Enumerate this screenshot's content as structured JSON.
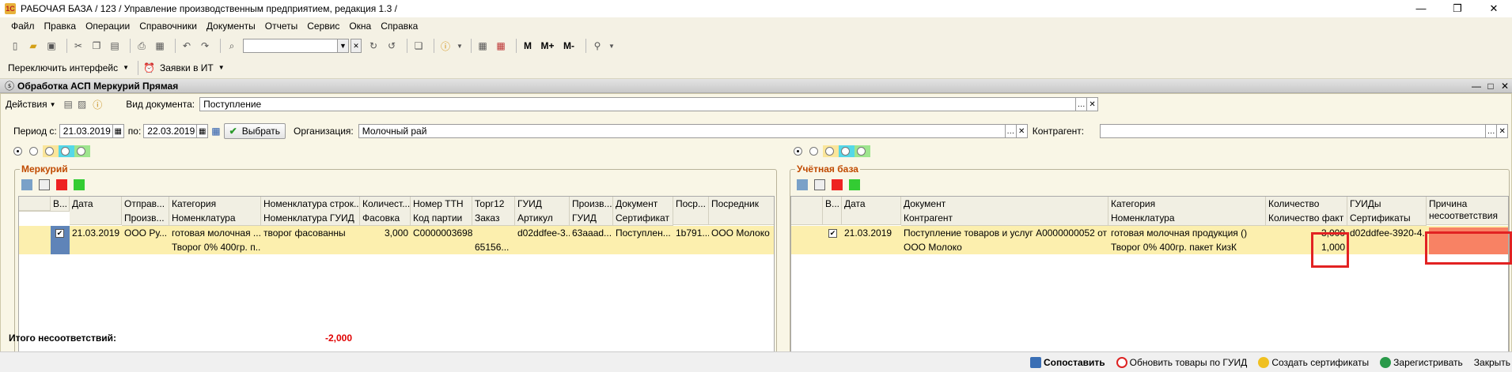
{
  "window": {
    "title": "РАБОЧАЯ БАЗА / 123 /  Управление производственным предприятием, редакция 1.3 /"
  },
  "menu": [
    "Файл",
    "Правка",
    "Операции",
    "Справочники",
    "Документы",
    "Отчеты",
    "Сервис",
    "Окна",
    "Справка"
  ],
  "toolbar2": {
    "switch_interface": "Переключить интерфейс",
    "tickets": "Заявки в ИТ"
  },
  "toolbar1": {
    "m": "M",
    "mplus": "M+",
    "mminus": "M-"
  },
  "form": {
    "title": "Обработка  АСП Меркурий Прямая",
    "actions": "Действия",
    "doc_type_label": "Вид документа:",
    "doc_type_value": "Поступление",
    "period_label": "Период с:",
    "period_from": "21.03.2019",
    "period_to_label": "по:",
    "period_to": "22.03.2019",
    "select_btn": "Выбрать",
    "org_label": "Организация:",
    "org_value": "Молочный рай",
    "contractor_label": "Контрагент:",
    "contractor_value": ""
  },
  "mercury": {
    "label": "Меркурий",
    "header_row1": [
      "В...",
      "Дата",
      "Отправ...",
      "Категория",
      "Номенклатура строк...",
      "Количест...",
      "Номер ТТН",
      "Торг12",
      "ГУИД",
      "Произв...",
      "Документ",
      "Поср...",
      "Посредник"
    ],
    "header_row2": [
      "Произв...",
      "Номенклатура",
      "Номенклатура ГУИД",
      "Фасовка",
      "Код партии",
      "Заказ",
      "Артикул",
      "ГУИД",
      "Сертификат"
    ],
    "row1": [
      "21.03.2019",
      "ООО Ру...",
      "готовая молочная ...",
      "творог фасованны",
      "3,000",
      "С0000003698",
      "",
      "d02ddfee-3...",
      "63aaad...",
      "Поступлен...",
      "1b791...",
      "ООО Молоко"
    ],
    "row2": [
      "Творог 0% 400гр. п...",
      "65156..."
    ]
  },
  "account": {
    "label": "Учётная база",
    "header_row1": [
      "В...",
      "Дата",
      "Документ",
      "Категория",
      "Количество",
      "ГУИДы",
      "Причина несоответствия"
    ],
    "header_row2": [
      "Контрагент",
      "Номенклатура",
      "Количество факт",
      "Сертификаты"
    ],
    "row1": [
      "21.03.2019",
      "Поступление товаров и услуг А0000000052 от 2...",
      "готовая молочная продукция ()",
      "3,000",
      "d02ddfee-3920-4..."
    ],
    "row2": [
      "ООО Молоко",
      "Творог 0% 400гр. пакет КизК",
      "1,000"
    ]
  },
  "totals": {
    "label": "Итого несоответствий:",
    "value": "-2,000"
  },
  "statusbar": [
    "Сопоставить",
    "Обновить товары по ГУИД",
    "Создать сертификаты",
    "Зарегистривать",
    "Закрыть"
  ],
  "colors": {
    "accent": "#c04a00",
    "highlight": "#e22222",
    "mismatch_fill": "#f88264",
    "selected_row": "#fcefae",
    "negative": "#e00000"
  }
}
